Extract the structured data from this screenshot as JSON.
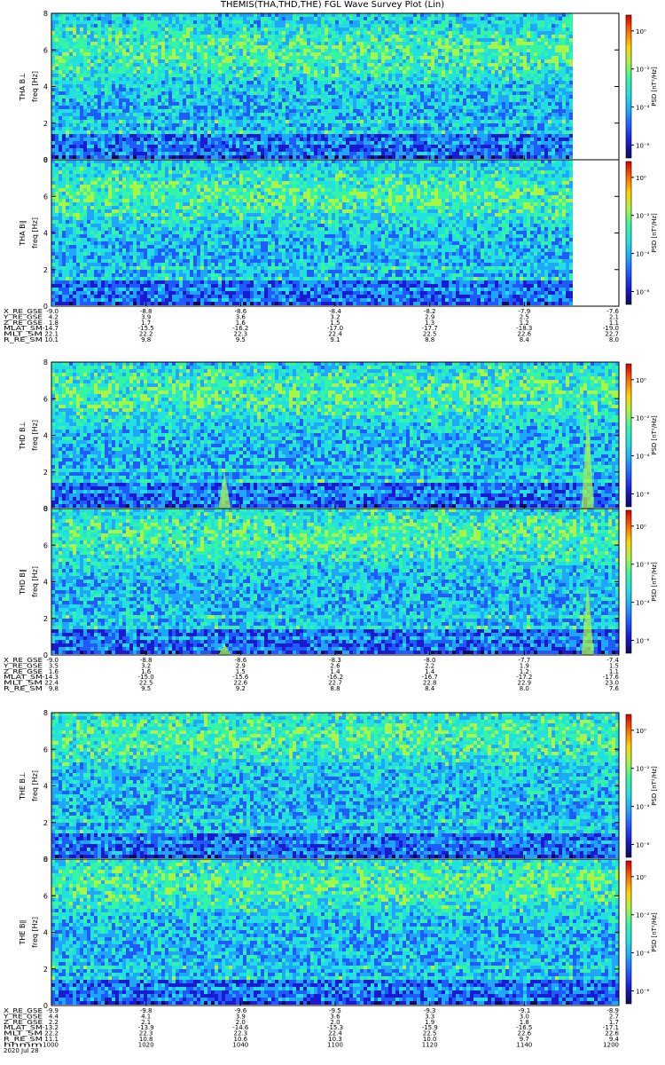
{
  "title": "THEMIS(THA,THD,THE) FGL Wave Survey Plot (Lin)",
  "date_label": "2020 Jul 28",
  "colorbar_label": "PSD [nT²/Hz]",
  "colorbar_ticks": [
    "10⁰",
    "10⁻²",
    "10⁻⁴",
    "10⁻⁶"
  ],
  "colors": {
    "colormap": [
      "#0b0b5e",
      "#1a1ad0",
      "#1f5bff",
      "#1fa7ff",
      "#22e0e0",
      "#35f5a5",
      "#a8f546",
      "#ffd400",
      "#ff6a00",
      "#d40000"
    ]
  },
  "chart_data": [
    {
      "type": "heatmap",
      "group": "THA",
      "panels": [
        {
          "name": "THA B⊥",
          "ylabel": "freq [Hz]",
          "ylim": [
            0,
            8
          ],
          "yticks": [
            "0",
            "2",
            "4",
            "6",
            "8"
          ],
          "data_end_fraction": 0.92,
          "spikes": [],
          "mean_band_hz": 5.9
        },
        {
          "name": "THA B∥",
          "ylabel": "freq [Hz]",
          "ylim": [
            0,
            8
          ],
          "yticks": [
            "0",
            "2",
            "4",
            "6",
            "8"
          ],
          "data_end_fraction": 0.92,
          "spikes": [],
          "mean_band_hz": 6.1
        }
      ],
      "ephemeris": [
        {
          "label": "X_RE_GSE",
          "values": [
            "-9.0",
            "-8.8",
            "-8.6",
            "-8.4",
            "-8.2",
            "-7.9",
            "-7.6"
          ]
        },
        {
          "label": "Y_RE_GSE",
          "values": [
            "4.2",
            "3.9",
            "3.6",
            "3.2",
            "2.9",
            "2.5",
            "2.1"
          ]
        },
        {
          "label": "Z_RE_GSE",
          "values": [
            "1.8",
            "1.7",
            "1.6",
            "1.5",
            "1.3",
            "1.2",
            "1.1"
          ]
        },
        {
          "label": "MLAT_SM",
          "values": [
            "-14.7",
            "-15.5",
            "-16.2",
            "-17.0",
            "-17.7",
            "-18.3",
            "-19.0"
          ]
        },
        {
          "label": "MLT_SM",
          "values": [
            "22.1",
            "22.2",
            "22.3",
            "22.4",
            "22.5",
            "22.6",
            "22.7"
          ]
        },
        {
          "label": "R_RE_SM",
          "values": [
            "10.1",
            "9.8",
            "9.5",
            "9.1",
            "8.8",
            "8.4",
            "8.0"
          ]
        }
      ]
    },
    {
      "type": "heatmap",
      "group": "THD",
      "panels": [
        {
          "name": "THD B⊥",
          "ylabel": "freq [Hz]",
          "ylim": [
            0,
            8
          ],
          "yticks": [
            "0",
            "2",
            "4",
            "6",
            "8"
          ],
          "data_end_fraction": 1.0,
          "spikes": [
            {
              "x_fraction": 0.305,
              "top_hz": 2.0
            },
            {
              "x_fraction": 0.945,
              "top_hz": 5.5
            }
          ],
          "mean_band_hz": 6.3
        },
        {
          "name": "THD B∥",
          "ylabel": "freq [Hz]",
          "ylim": [
            0,
            8
          ],
          "yticks": [
            "0",
            "2",
            "4",
            "6",
            "8"
          ],
          "data_end_fraction": 1.0,
          "spikes": [
            {
              "x_fraction": 0.305,
              "top_hz": 0.6
            },
            {
              "x_fraction": 0.945,
              "top_hz": 4.0
            }
          ],
          "mean_band_hz": 6.5
        }
      ],
      "ephemeris": [
        {
          "label": "X_RE_GSE",
          "values": [
            "-9.0",
            "-8.8",
            "-8.6",
            "-8.3",
            "-8.0",
            "-7.7",
            "-7.4"
          ]
        },
        {
          "label": "Y_RE_GSE",
          "values": [
            "3.5",
            "3.2",
            "2.9",
            "2.6",
            "2.2",
            "1.9",
            "1.5"
          ]
        },
        {
          "label": "Z_RE_GSE",
          "values": [
            "1.6",
            "1.6",
            "1.5",
            "1.4",
            "1.4",
            "1.2",
            "1.1"
          ]
        },
        {
          "label": "MLAT_SM",
          "values": [
            "-14.3",
            "-15.0",
            "-15.6",
            "-16.2",
            "-16.7",
            "-17.2",
            "-17.6"
          ]
        },
        {
          "label": "MLT_SM",
          "values": [
            "22.4",
            "22.5",
            "22.6",
            "22.7",
            "22.8",
            "22.9",
            "23.0"
          ]
        },
        {
          "label": "R_RE_SM",
          "values": [
            "9.8",
            "9.5",
            "9.2",
            "8.8",
            "8.4",
            "8.0",
            "7.6"
          ]
        }
      ]
    },
    {
      "type": "heatmap",
      "group": "THE",
      "panels": [
        {
          "name": "THE B⊥",
          "ylabel": "freq [Hz]",
          "ylim": [
            0,
            8
          ],
          "yticks": [
            "0",
            "2",
            "4",
            "6",
            "8"
          ],
          "data_end_fraction": 1.0,
          "spikes": [],
          "mean_band_hz": 6.7
        },
        {
          "name": "THE B∥",
          "ylabel": "freq [Hz]",
          "ylim": [
            0,
            8
          ],
          "yticks": [
            "0",
            "2",
            "4",
            "6",
            "8"
          ],
          "data_end_fraction": 1.0,
          "spikes": [],
          "mean_band_hz": 6.7
        }
      ],
      "ephemeris": [
        {
          "label": "X_RE_GSE",
          "values": [
            "-9.9",
            "-9.8",
            "-9.6",
            "-9.5",
            "-9.3",
            "-9.1",
            "-8.9"
          ]
        },
        {
          "label": "Y_RE_GSE",
          "values": [
            "4.4",
            "4.1",
            "3.9",
            "3.6",
            "3.3",
            "3.0",
            "2.7"
          ]
        },
        {
          "label": "Z_RE_GSE",
          "values": [
            "2.2",
            "2.1",
            "2.0",
            "2.0",
            "1.9",
            "1.8",
            "1.7"
          ]
        },
        {
          "label": "MLAT_SM",
          "values": [
            "-13.2",
            "-13.9",
            "-14.6",
            "-15.3",
            "-15.9",
            "-16.5",
            "-17.1"
          ]
        },
        {
          "label": "MLT_SM",
          "values": [
            "22.2",
            "22.3",
            "22.3",
            "22.4",
            "22.5",
            "22.6",
            "22.6"
          ]
        },
        {
          "label": "R_RE_SM",
          "values": [
            "11.1",
            "10.8",
            "10.6",
            "10.3",
            "10.0",
            "9.7",
            "9.4"
          ]
        },
        {
          "label": "hhmm",
          "values": [
            "1000",
            "1020",
            "1040",
            "1100",
            "1120",
            "1140",
            "1200"
          ]
        }
      ]
    }
  ]
}
